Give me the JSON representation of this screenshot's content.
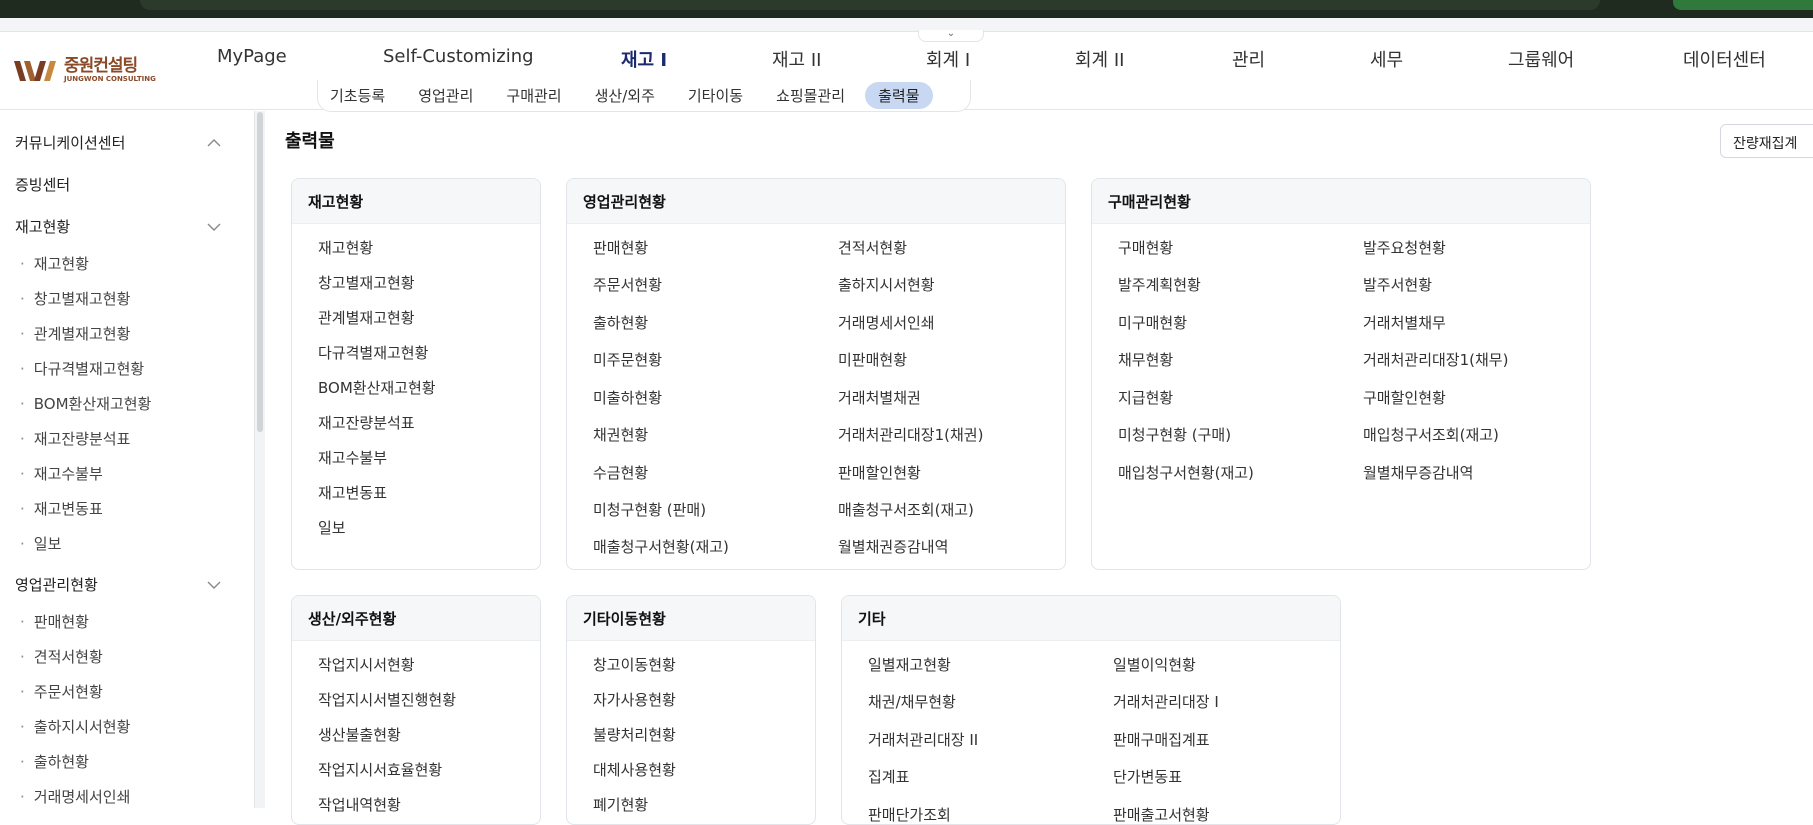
{
  "header": {
    "logo_ko": "중원컨설팅",
    "logo_en": "JUNGWON CONSULTING",
    "topnav": [
      "MyPage",
      "Self-Customizing",
      "재고 I",
      "재고 II",
      "회계 I",
      "회계 II",
      "관리",
      "세무",
      "그룹웨어",
      "데이터센터"
    ],
    "subnav": [
      "기초등록",
      "영업관리",
      "구매관리",
      "생산/외주",
      "기타이동",
      "쇼핑몰관리",
      "출력물"
    ],
    "collapse_icon": "⌄"
  },
  "sidebar": {
    "groups": [
      {
        "label": "커뮤니케이션센터",
        "expanded": true
      },
      {
        "label": "증빙센터"
      },
      {
        "label": "재고현황",
        "expanded": true
      },
      {
        "label": "영업관리현황",
        "expanded": true
      }
    ],
    "inventory_items": [
      "재고현황",
      "창고별재고현황",
      "관계별재고현황",
      "다규격별재고현황",
      "BOM환산재고현황",
      "재고잔량분석표",
      "재고수불부",
      "재고변동표",
      "일보"
    ],
    "sales_items": [
      "판매현황",
      "견적서현황",
      "주문서현황",
      "출하지시서현황",
      "출하현황",
      "거래명세서인쇄"
    ]
  },
  "main": {
    "title": "출력물",
    "summary_button": "잔량재집계",
    "cards": {
      "inventory": {
        "title": "재고현황",
        "links": [
          "재고현황",
          "창고별재고현황",
          "관계별재고현황",
          "다규격별재고현황",
          "BOM환산재고현황",
          "재고잔량분석표",
          "재고수불부",
          "재고변동표",
          "일보"
        ]
      },
      "sales": {
        "title": "영업관리현황",
        "left": [
          "판매현황",
          "주문서현황",
          "출하현황",
          "미주문현황",
          "미출하현황",
          "채권현황",
          "수금현황",
          "미청구현황 (판매)",
          "매출청구서현황(재고)"
        ],
        "right": [
          "견적서현황",
          "출하지시서현황",
          "거래명세서인쇄",
          "미판매현황",
          "거래처별채권",
          "거래처관리대장1(채권)",
          "판매할인현황",
          "매출청구서조회(재고)",
          "월별채권증감내역"
        ]
      },
      "purchase": {
        "title": "구매관리현황",
        "left": [
          "구매현황",
          "발주계획현황",
          "미구매현황",
          "채무현황",
          "지급현황",
          "미청구현황 (구매)",
          "매입청구서현황(재고)"
        ],
        "right": [
          "발주요청현황",
          "발주서현황",
          "거래처별채무",
          "거래처관리대장1(채무)",
          "구매할인현황",
          "매입청구서조회(재고)",
          "월별채무증감내역"
        ]
      },
      "production": {
        "title": "생산/외주현황",
        "links": [
          "작업지시서현황",
          "작업지시서별진행현황",
          "생산불출현황",
          "작업지시서효율현황",
          "작업내역현황"
        ]
      },
      "misc_move": {
        "title": "기타이동현황",
        "links": [
          "창고이동현황",
          "자가사용현황",
          "불량처리현황",
          "대체사용현황",
          "폐기현황"
        ]
      },
      "etc": {
        "title": "기타",
        "left": [
          "일별재고현황",
          "채권/채무현황",
          "거래처관리대장 II",
          "집계표",
          "판매단가조회"
        ],
        "right": [
          "일별이익현황",
          "거래처관리대장 I",
          "판매구매집계표",
          "단가변동표",
          "판매출고서현황"
        ]
      }
    }
  },
  "colors": {
    "accent": "#1c2b6e",
    "active_tab_bg": "#c9d8f2",
    "logo": "#8a4a2a"
  }
}
